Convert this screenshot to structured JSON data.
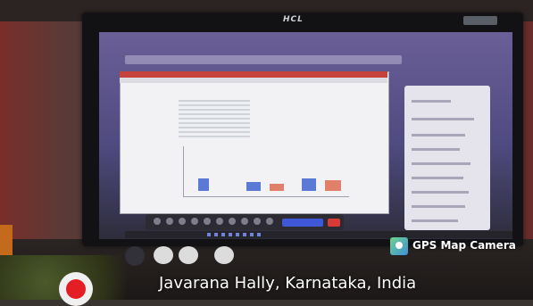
{
  "monitor": {
    "brand": "HCL"
  },
  "stamp": {
    "app_label": "GPS Map Camera",
    "location": "Javarana Hally, Karnataka, India",
    "icon": "map-pin-icon",
    "app_icon": "gps-map-camera-icon"
  },
  "colors": {
    "meet_background": "#5b5590",
    "present_button": "#3f57d8",
    "leave_button": "#d93a36",
    "pin": "#e41e25"
  }
}
